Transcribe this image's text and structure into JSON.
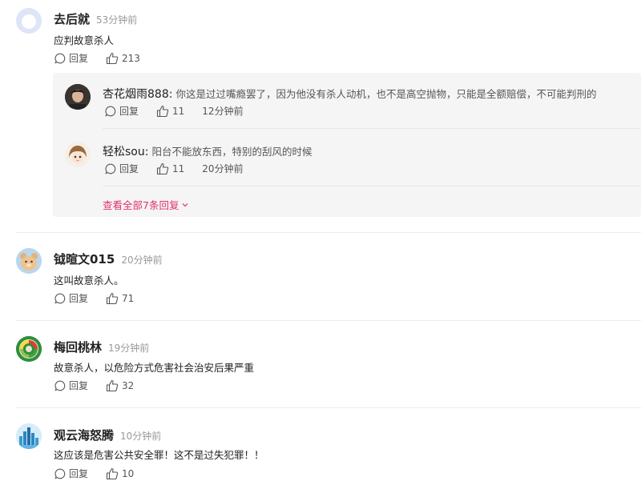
{
  "comments": [
    {
      "user": "去后就",
      "time": "53分钟前",
      "text": "应判故意杀人",
      "reply_label": "回复",
      "likes": "213"
    },
    {
      "user": "钺暄文015",
      "time": "20分钟前",
      "text": "这叫故意杀人。",
      "reply_label": "回复",
      "likes": "71"
    },
    {
      "user": "梅回桃林",
      "time": "19分钟前",
      "text": "故意杀人，以危险方式危害社会治安后果严重",
      "reply_label": "回复",
      "likes": "32"
    },
    {
      "user": "观云海怒腾",
      "time": "10分钟前",
      "text": "这应该是危害公共安全罪！这不是过失犯罪！！",
      "reply_label": "回复",
      "likes": "10"
    }
  ],
  "replies": [
    {
      "user": "杏花烟雨888:",
      "text": "你这是过过嘴瘾罢了，因为他没有杀人动机，也不是高空抛物，只能是全额赔偿，不可能判刑的",
      "reply_label": "回复",
      "likes": "11",
      "time": "12分钟前"
    },
    {
      "user": "轻松sou:",
      "text": "阳台不能放东西，特别的刮风的时候",
      "reply_label": "回复",
      "likes": "11",
      "time": "20分钟前"
    }
  ],
  "view_all": "查看全部7条回复",
  "colors": {
    "accent": "#e0326a",
    "text": "#222222",
    "muted": "#999999",
    "reply_bg": "#f5f5f6"
  },
  "icons": [
    "reply-icon",
    "thumbs-up-icon",
    "chevron-down-icon"
  ]
}
